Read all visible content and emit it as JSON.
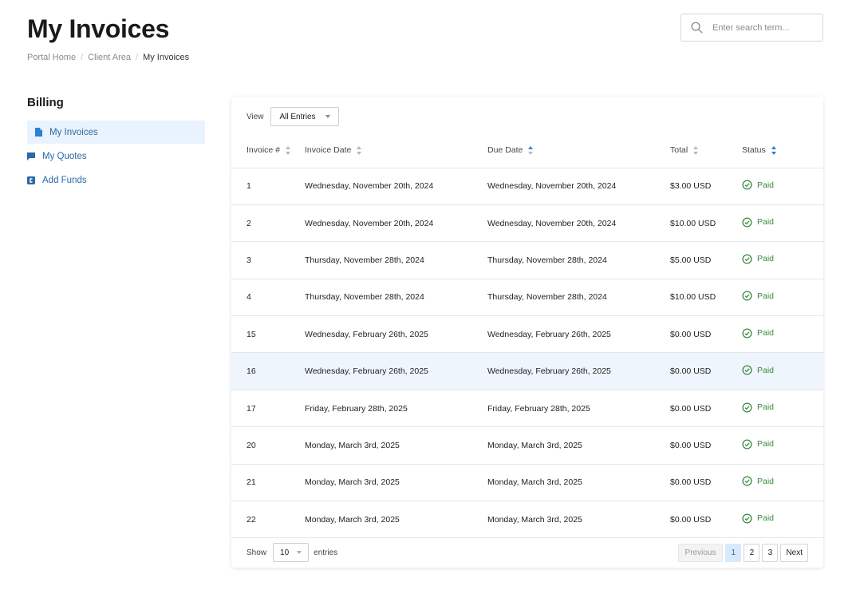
{
  "header": {
    "title": "My Invoices",
    "breadcrumb": [
      "Portal Home",
      "Client Area",
      "My Invoices"
    ],
    "search_placeholder": "Enter search term..."
  },
  "sidebar": {
    "title": "Billing",
    "items": [
      {
        "label": "My Invoices",
        "icon": "file-icon",
        "active": true
      },
      {
        "label": "My Quotes",
        "icon": "comment-icon",
        "active": false
      },
      {
        "label": "Add Funds",
        "icon": "cc-icon",
        "active": false
      }
    ]
  },
  "toolbar": {
    "view_label": "View",
    "view_value": "All Entries"
  },
  "table": {
    "columns": [
      "Invoice #",
      "Invoice Date",
      "Due Date",
      "Total",
      "Status"
    ],
    "rows": [
      {
        "num": "1",
        "invoice_date": "Wednesday, November 20th, 2024",
        "due_date": "Wednesday, November 20th, 2024",
        "total": "$3.00 USD",
        "status": "Paid"
      },
      {
        "num": "2",
        "invoice_date": "Wednesday, November 20th, 2024",
        "due_date": "Wednesday, November 20th, 2024",
        "total": "$10.00 USD",
        "status": "Paid"
      },
      {
        "num": "3",
        "invoice_date": "Thursday, November 28th, 2024",
        "due_date": "Thursday, November 28th, 2024",
        "total": "$5.00 USD",
        "status": "Paid"
      },
      {
        "num": "4",
        "invoice_date": "Thursday, November 28th, 2024",
        "due_date": "Thursday, November 28th, 2024",
        "total": "$10.00 USD",
        "status": "Paid"
      },
      {
        "num": "15",
        "invoice_date": "Wednesday, February 26th, 2025",
        "due_date": "Wednesday, February 26th, 2025",
        "total": "$0.00 USD",
        "status": "Paid"
      },
      {
        "num": "16",
        "invoice_date": "Wednesday, February 26th, 2025",
        "due_date": "Wednesday, February 26th, 2025",
        "total": "$0.00 USD",
        "status": "Paid"
      },
      {
        "num": "17",
        "invoice_date": "Friday, February 28th, 2025",
        "due_date": "Friday, February 28th, 2025",
        "total": "$0.00 USD",
        "status": "Paid"
      },
      {
        "num": "20",
        "invoice_date": "Monday, March 3rd, 2025",
        "due_date": "Monday, March 3rd, 2025",
        "total": "$0.00 USD",
        "status": "Paid"
      },
      {
        "num": "21",
        "invoice_date": "Monday, March 3rd, 2025",
        "due_date": "Monday, March 3rd, 2025",
        "total": "$0.00 USD",
        "status": "Paid"
      },
      {
        "num": "22",
        "invoice_date": "Monday, March 3rd, 2025",
        "due_date": "Monday, March 3rd, 2025",
        "total": "$0.00 USD",
        "status": "Paid"
      }
    ]
  },
  "footer": {
    "show_label": "Show",
    "page_length": "10",
    "entries_label": "entries",
    "previous_label": "Previous",
    "pages": [
      "1",
      "2",
      "3"
    ],
    "next_label": "Next"
  },
  "colors": {
    "accent": "#2a6aa7",
    "status_paid": "#3b8a3e",
    "highlight": "#eef5fd"
  }
}
